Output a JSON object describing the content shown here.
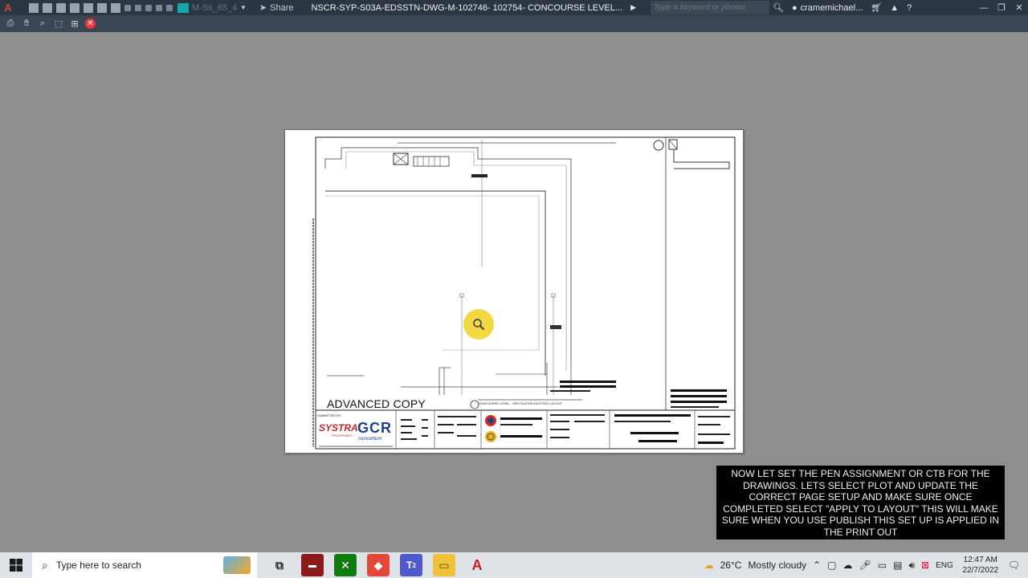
{
  "titlebar": {
    "app_logo": "A",
    "workspace": "M-Ss_65_4",
    "share_label": "Share",
    "document_title": "NSCR-SYP-S03A-EDSSTN-DWG-M-102746- 102754- CONCOURSE LEVEL...",
    "search_placeholder": "Type a keyword or phrase",
    "user_name": "cramemichael..."
  },
  "sheet": {
    "advanced_copy": "ADVANCED COPY",
    "submitted_by": "SUBMITTED BY:",
    "systra": "SYSTRA",
    "systra_sub": "PHILIPPINES",
    "gcr": "GCR",
    "gcr_sub": "consortium",
    "drawing_title": "CONCOURSE LEVEL - VENTILATION DUCTING LAYOUT"
  },
  "caption": {
    "text": "NOW LET SET THE PEN ASSIGNMENT OR CTB FOR THE DRAWINGS. LETS SELECT PLOT AND UPDATE THE CORRECT PAGE SETUP AND MAKE SURE ONCE COMPLETED SELECT \"APPLY TO LAYOUT\" THIS WILL MAKE SURE WHEN YOU USE PUBLISH THIS SET UP IS APPLIED IN THE PRINT OUT"
  },
  "taskbar": {
    "search_placeholder": "Type here to search",
    "teams_badge": "2",
    "weather_temp": "26°C",
    "weather_desc": "Mostly cloudy",
    "language": "ENG",
    "time": "12:47 AM",
    "date": "22/7/2022"
  },
  "colors": {
    "titlebar_bg": "#2b3643",
    "toolbar_bg": "#3b4653",
    "canvas_bg": "#8e8e8e",
    "autocad_red": "#e04040",
    "magnifier_yellow": "#f2d83b"
  }
}
